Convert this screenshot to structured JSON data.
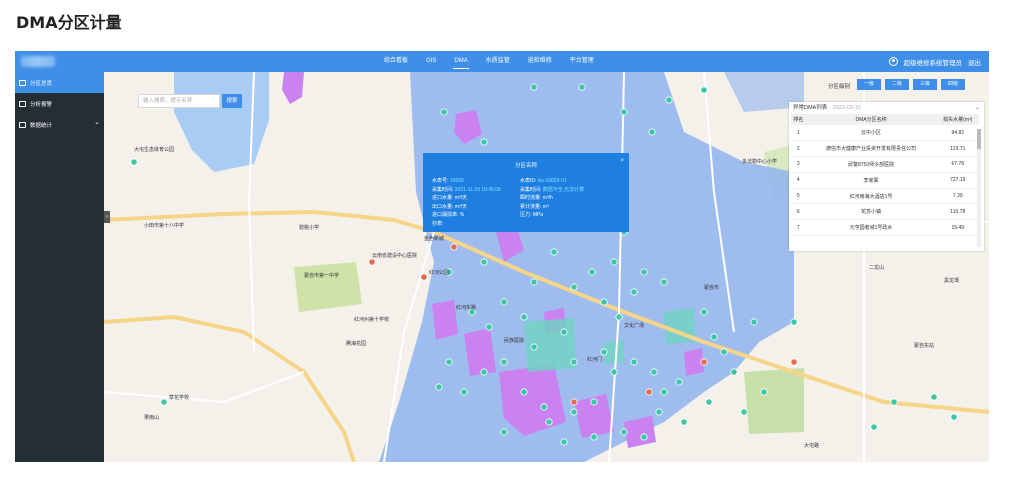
{
  "page_title": "DMA分区计量",
  "nav": {
    "items": [
      "综合看板",
      "GIS",
      "DMA",
      "水质监管",
      "巡检维修",
      "平台管理"
    ],
    "active_index": 2
  },
  "user": {
    "name": "超级维修系统管理员",
    "logout": "退出"
  },
  "sidebar": {
    "items": [
      {
        "label": "分区总览",
        "active": true
      },
      {
        "label": "分析报警",
        "active": false
      },
      {
        "label": "数据统计",
        "active": false,
        "has_children": true
      }
    ]
  },
  "search": {
    "placeholder": "输入搜索，提示名称",
    "button": "搜索"
  },
  "zone_level": {
    "label": "分区级别",
    "buttons": [
      "一级",
      "二级",
      "三级",
      "四级"
    ]
  },
  "popup": {
    "title": "分区名称",
    "rows": [
      {
        "label": "水表号:",
        "value": "10659",
        "label2": "水表ID:",
        "value2": "lxs-10659-01"
      },
      {
        "label": "采集时间:",
        "value": "2021-11-29 10:45:08",
        "label2": "采集时间:",
        "value2": "数据不全,无法计算"
      },
      {
        "label": "进口水量:",
        "value": "",
        "unit": "m³/天",
        "label2": "瞬时流量:",
        "value2": "",
        "unit2": "m³/h"
      },
      {
        "label": "出口水量:",
        "value": "",
        "unit": "m³/天",
        "label2": "累计流量:",
        "value2": "",
        "unit2": "m³"
      },
      {
        "label": "进口漏损率:",
        "value": "",
        "unit": "%",
        "label2": "压力:",
        "value2": "",
        "unit2": "MPa"
      },
      {
        "label": "抄表:",
        "value": ""
      }
    ]
  },
  "anomaly_panel": {
    "title": "异常DMA列表",
    "date": "2022-03-15",
    "columns": [
      "排名",
      "DMA分区名称",
      "损失水量(m³)"
    ],
    "rows": [
      [
        "1",
        "云中小区",
        "94.82"
      ],
      [
        "2",
        "德信市大健康产业投资开发有限责任公司",
        "123.71"
      ],
      [
        "3",
        "武警8750师令部医院",
        "67.78"
      ],
      [
        "4",
        "李家寨",
        "727.19"
      ],
      [
        "5",
        "红河南海大酒店1号",
        "7.39"
      ],
      [
        "6",
        "花苏小镇",
        "110.78"
      ],
      [
        "7",
        "元亨国者城1号政水",
        "15.49"
      ]
    ]
  },
  "map_labels": [
    "大屯生态体育公园",
    "小田市第十八中学",
    "碧桃小学",
    "云南省建设中心医院",
    "红河公园",
    "蒙自市第一中学",
    "红河州第十学校",
    "金色新城",
    "红河东路",
    "草花学校",
    "腾海花园",
    "民族医院",
    "红河门",
    "蒙自市",
    "文化广场",
    "大屯路",
    "多法勒中心小学",
    "二龙山",
    "黑龙潭",
    "蒙自东站",
    "果雨山"
  ],
  "colors": {
    "topbar": "#3f8ee8",
    "sidebar": "#252d36",
    "dma_zone": "#8fb3ef",
    "anomaly_zone": "#c982ef",
    "meter_marker": "#3cc7a8",
    "alarm_marker": "#e26b50"
  }
}
